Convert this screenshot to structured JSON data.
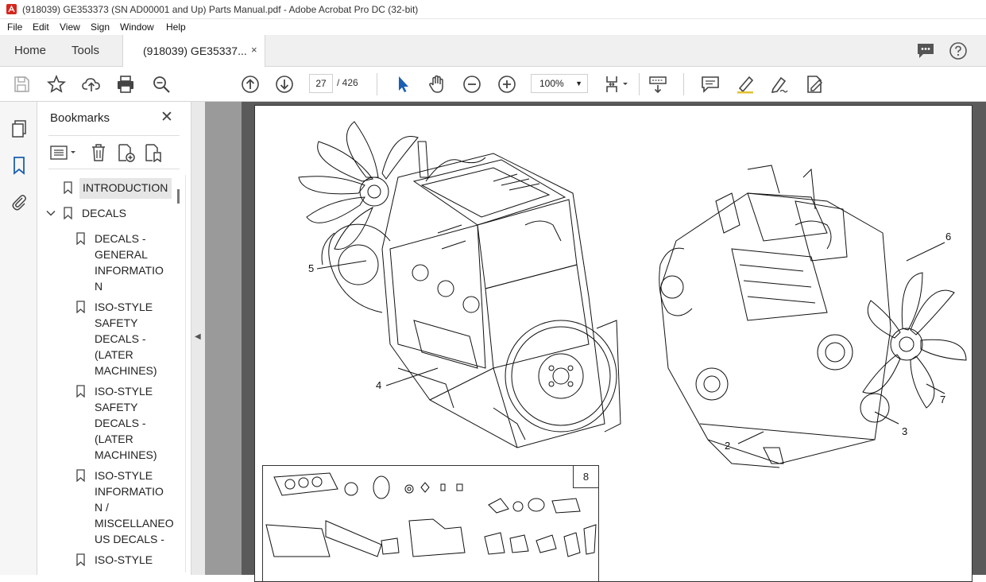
{
  "window": {
    "title": "(918039) GE353373 (SN AD00001 and Up) Parts Manual.pdf - Adobe Acrobat Pro DC (32-bit)"
  },
  "menu": [
    "File",
    "Edit",
    "View",
    "Sign",
    "Window",
    "Help"
  ],
  "tabs": {
    "home": "Home",
    "tools": "Tools",
    "document": "(918039) GE35337...",
    "close": "×"
  },
  "toolbar": {
    "current_page": "27",
    "total_pages": "/ 426",
    "zoom": "100%",
    "zoom_caret": "▼"
  },
  "bookmarks": {
    "title": "Bookmarks",
    "close": "✕",
    "items": [
      {
        "label": "INTRODUCTION"
      },
      {
        "label": "DECALS"
      },
      {
        "label": "DECALS - GENERAL INFORMATIO N"
      },
      {
        "label": "ISO-STYLE SAFETY DECALS - (LATER MACHINES)"
      },
      {
        "label": "ISO-STYLE SAFETY DECALS - (LATER MACHINES)"
      },
      {
        "label": "ISO-STYLE INFORMATIO N / MISCELLANEO US DECALS -"
      },
      {
        "label": "ISO-STYLE"
      }
    ],
    "lines": {
      "i2": [
        "DECALS -",
        "GENERAL",
        "INFORMATIO",
        "N"
      ],
      "i3": [
        "ISO-STYLE",
        "SAFETY",
        "DECALS -",
        "(LATER",
        "MACHINES)"
      ],
      "i4": [
        "ISO-STYLE",
        "SAFETY",
        "DECALS -",
        "(LATER",
        "MACHINES)"
      ],
      "i5": [
        "ISO-STYLE",
        "INFORMATIO",
        "N /",
        "MISCELLANEO",
        "US DECALS -"
      ],
      "i6": [
        "ISO-STYLE"
      ]
    }
  },
  "document": {
    "callouts": {
      "c2": "2",
      "c3": "3",
      "c4": "4",
      "c5": "5",
      "c6": "6",
      "c7": "7",
      "c8": "8"
    }
  }
}
